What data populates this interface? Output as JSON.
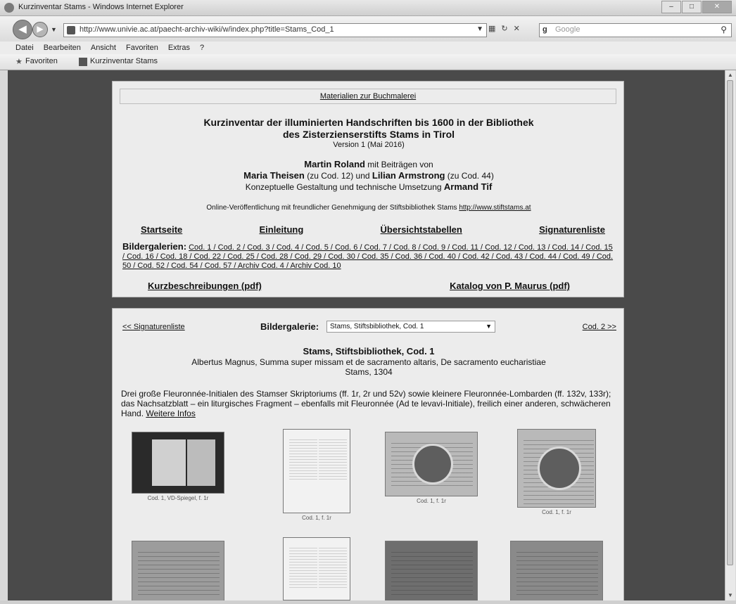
{
  "window": {
    "title": "Kurzinventar Stams - Windows Internet Explorer",
    "url": "http://www.univie.ac.at/paecht-archiv-wiki/w/index.php?title=Stams_Cod_1",
    "search_placeholder": "Google",
    "menu": [
      "Datei",
      "Bearbeiten",
      "Ansicht",
      "Favoriten",
      "Extras",
      "?"
    ],
    "favorites_label": "Favoriten",
    "tab_title": "Kurzinventar Stams"
  },
  "header": {
    "top_link": "Materialien zur Buchmalerei",
    "title_line1": "Kurzinventar der illuminierten Handschriften bis 1600 in der Bibliothek",
    "title_line2": "des Zisterzienserstifts Stams in Tirol",
    "version": "Version 1 (Mai 2016)",
    "author_main": "Martin Roland",
    "author_main_suffix": " mit Beiträgen von",
    "contrib1": "Maria Theisen",
    "contrib1_note": " (zu Cod. 12) und ",
    "contrib2": "Lilian Armstrong",
    "contrib2_note": " (zu Cod. 44)",
    "concept_prefix": "Konzeptuelle Gestaltung und technische Umsetzung ",
    "concept_name": "Armand Tif",
    "online_text": "Online-Veröffentlichung mit freundlicher Genehmigung der Stiftsbibliothek Stams ",
    "online_link": "http://www.stiftstams.at",
    "nav": [
      "Startseite",
      "Einleitung",
      "Übersichtstabellen",
      "Signaturenliste"
    ],
    "galleries_label": "Bildergalerien:",
    "galleries_text": "Cod. 1 / Cod. 2 / Cod. 3 / Cod. 4 / Cod. 5 / Cod. 6 / Cod. 7 / Cod. 8 / Cod. 9 / Cod. 11 / Cod. 12 / Cod. 13 / Cod. 14 / Cod. 15 / Cod. 16 / Cod. 18 / Cod. 22 / Cod. 25 / Cod. 28 / Cod. 29 / Cod. 30 / Cod. 35 / Cod. 36 / Cod. 40 / Cod. 42 / Cod. 43 / Cod. 44 / Cod. 49 / Cod. 50 / Cod. 52 / Cod. 54 / Cod. 57 / Archiv Cod. 4 / Archiv Cod. 10",
    "pdf_left": "Kurzbeschreibungen (pdf)",
    "pdf_right": "Katalog von P. Maurus (pdf)"
  },
  "gallery": {
    "prev_link": "<< Signaturenliste",
    "label": "Bildergalerie:",
    "selected": "Stams, Stiftsbibliothek, Cod. 1",
    "next_link": "Cod. 2 >>",
    "shelfmark": "Stams, Stiftsbibliothek, Cod. 1",
    "work_line1": "Albertus Magnus, Summa super missam et de sacramento altaris, De sacramento eucharistiae",
    "work_line2": "Stams, 1304",
    "description": "Drei große Fleuronnée-Initialen des Stamser Skriptoriums (ff. 1r, 2r und 52v) sowie kleinere Fleuronnée-Lombarden (ff. 132v, 133r); das Nachsatzblatt – ein liturgisches Fragment – ebenfalls mit Fleuronnée (Ad te levavi-Initiale), freilich einer anderen, schwächeren Hand. ",
    "more_link": "Weitere Infos",
    "thumbnails": [
      {
        "caption": "Cod. 1, VD-Spiegel, f. 1r",
        "style": "dark"
      },
      {
        "caption": "Cod. 1, f. 1r",
        "style": "light"
      },
      {
        "caption": "Cod. 1, f. 1r",
        "style": "mid"
      },
      {
        "caption": "Cod. 1, f. 1r",
        "style": "mid"
      },
      {
        "caption": "",
        "style": "mid"
      },
      {
        "caption": "",
        "style": "light"
      },
      {
        "caption": "",
        "style": "mid"
      },
      {
        "caption": "",
        "style": "mid"
      }
    ]
  }
}
